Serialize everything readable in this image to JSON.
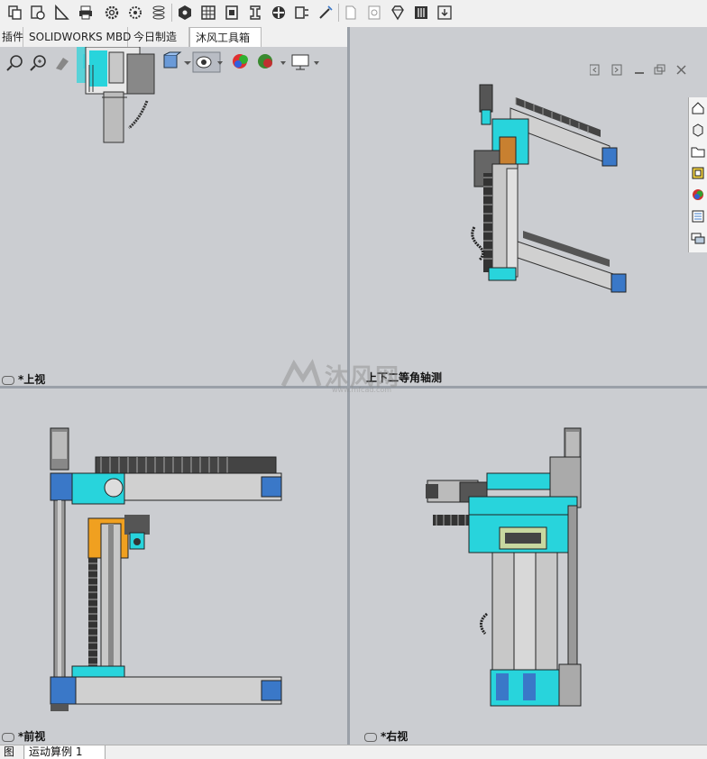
{
  "tabs": [
    {
      "label": "插件",
      "active": false
    },
    {
      "label": "SOLIDWORKS MBD",
      "active": false
    },
    {
      "label": "今日制造",
      "active": false
    },
    {
      "label": "沐风工具箱",
      "active": true
    }
  ],
  "toolbar_icons": [
    "copy-icon",
    "settings-icon",
    "ruler-icon",
    "print-icon",
    "gear-icon",
    "gear2-icon",
    "layers-icon",
    "hex-icon",
    "grid-icon",
    "block-icon",
    "bracket-icon",
    "target-icon",
    "route-icon",
    "wand-icon",
    "doc-icon",
    "image-icon",
    "diamond-icon",
    "sliders-icon",
    "download-icon"
  ],
  "views": {
    "top": {
      "label": "*上视"
    },
    "iso": {
      "label": "上下二等角轴测"
    },
    "front": {
      "label": "*前视"
    },
    "right": {
      "label": "*右视"
    }
  },
  "watermark": {
    "text": "沐风网",
    "url": "www.mfcad.com"
  },
  "bottom_tabs": [
    {
      "label": "图"
    },
    {
      "label": "运动算例 1"
    }
  ],
  "colors": {
    "cyan": "#28d4dc",
    "orange": "#f0a020",
    "steel": "#c8c8c8",
    "dark": "#333333",
    "blue": "#3a78c8"
  }
}
